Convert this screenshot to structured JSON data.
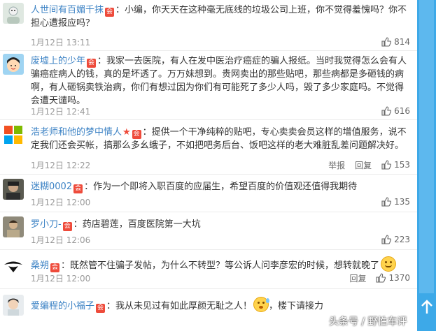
{
  "comments": [
    {
      "username": "人世间有百媚千抹",
      "star": "",
      "vip_badge": "会",
      "text": "：小编，你天天在这种毫无底线的垃圾公司上班，你不觉得羞愧吗？你不担心遭报应吗？",
      "time": "1月12日 13:11",
      "likes": "814",
      "reply": "",
      "report": "",
      "emoji": "",
      "text_after_emoji": ""
    },
    {
      "username": "废墟上的少年",
      "star": "",
      "vip_badge": "会",
      "text": "：我家一去医院，有人在发中医治疗癌症的骗人报纸。当时我觉得怎么会有人骗癌症病人的钱，真的是坏透了。万万妹想到。贵网卖出的那些贴吧，那些病都是多砸钱的病啊，有人砸锅卖铁治病，你们有想过因为你们有可能死了多少人吗，毁了多少家庭吗。不觉得会遭天谴吗。",
      "time": "1月12日 12:41",
      "likes": "616",
      "reply": "",
      "report": "",
      "emoji": "",
      "text_after_emoji": ""
    },
    {
      "username": "浩老师和他的梦中情人",
      "star": "★",
      "vip_badge": "会",
      "text": "：提供一个干净纯粹的贴吧，专心卖卖会员这样的增值服务，说不定我们还会买帐，搞那么多幺蛾子，不如把吧务后台、饭吧这样的老大难脏乱差问题解决好。",
      "time": "1月12日 12:22",
      "likes": "153",
      "reply": "回复",
      "report": "举报",
      "emoji": "",
      "text_after_emoji": ""
    },
    {
      "username": "迷糊0002",
      "star": "",
      "vip_badge": "会",
      "text": "：作为一个即将入职百度的应届生，希望百度的价值观还值得我期待",
      "time": "1月12日 12:00",
      "likes": "135",
      "reply": "",
      "report": "",
      "emoji": "",
      "text_after_emoji": ""
    },
    {
      "username": "罗小刀-",
      "star": "",
      "vip_badge": "会",
      "text": "：药店碧莲，百度医院第一大坑",
      "time": "1月12日 12:06",
      "likes": "223",
      "reply": "",
      "report": "",
      "emoji": "",
      "text_after_emoji": ""
    },
    {
      "username": "桑朔",
      "star": "",
      "vip_badge": "会",
      "text": "：既然管不住骗子发帖，为什么不转型？等公诉人问李彦宏的时候，想转就晚了",
      "time": "1月12日 12:00",
      "likes": "1370",
      "reply": "回复",
      "report": "",
      "emoji": "smile",
      "text_after_emoji": ""
    },
    {
      "username": "爱编程的小福子",
      "star": "",
      "vip_badge": "会",
      "text": "：我从未见过有如此厚颜无耻之人！",
      "time": "",
      "likes": "",
      "reply": "",
      "report": "",
      "emoji": "sweat",
      "text_after_emoji": "，楼下请接力"
    }
  ],
  "watermark": "头条号 / 野性车评",
  "colors": {
    "username": "#3d83c5",
    "vip": "#ee4b3b",
    "scrollbar": "#3da9e8"
  },
  "icons": {
    "like": "thumbs-up-icon",
    "scroll_up": "arrow-up-icon"
  }
}
